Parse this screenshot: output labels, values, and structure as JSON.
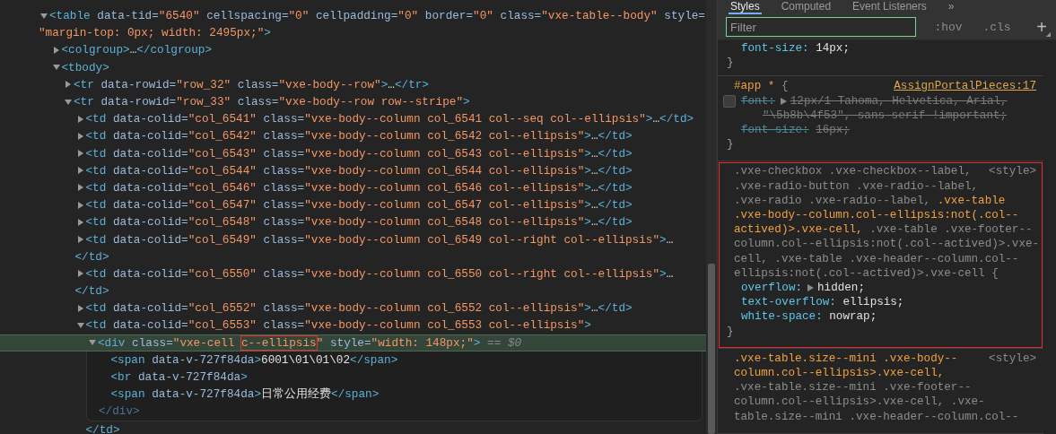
{
  "elements": [
    {
      "selected": false,
      "expanded": true,
      "lines": [
        [
          {
            "kind": "tag",
            "text": "<table"
          },
          {
            "kind": "attr",
            "text": " data-tid="
          },
          {
            "kind": "val",
            "text": "\"6540\""
          },
          {
            "kind": "attr",
            "text": " cellspacing="
          },
          {
            "kind": "val",
            "text": "\"0\""
          },
          {
            "kind": "attr",
            "text": " cellpadding="
          },
          {
            "kind": "val",
            "text": "\"0\""
          },
          {
            "kind": "attr",
            "text": " border="
          },
          {
            "kind": "val",
            "text": "\"0\""
          },
          {
            "kind": "attr",
            "text": " class="
          },
          {
            "kind": "val",
            "text": "\"vxe-table--body\""
          },
          {
            "kind": "attr",
            "text": " style="
          }
        ],
        [
          {
            "kind": "val",
            "text": "\"margin-top: 0px; width: 2495px;\""
          },
          {
            "kind": "tag",
            "text": ">"
          }
        ]
      ],
      "children": [
        {
          "selected": false,
          "expanded": false,
          "lines": [
            [
              {
                "kind": "tag",
                "text": "<colgroup>"
              },
              {
                "kind": "text",
                "text": "…"
              },
              {
                "kind": "tag",
                "text": "</colgroup>"
              }
            ]
          ]
        },
        {
          "selected": false,
          "expanded": true,
          "lines": [
            [
              {
                "kind": "tag",
                "text": "<tbody>"
              }
            ]
          ],
          "children": [
            {
              "selected": false,
              "expanded": false,
              "lines": [
                [
                  {
                    "kind": "tag",
                    "text": "<tr"
                  },
                  {
                    "kind": "attr",
                    "text": " data-rowid="
                  },
                  {
                    "kind": "val",
                    "text": "\"row_32\""
                  },
                  {
                    "kind": "attr",
                    "text": " class="
                  },
                  {
                    "kind": "val",
                    "text": "\"vxe-body--row\""
                  },
                  {
                    "kind": "tag",
                    "text": ">"
                  },
                  {
                    "kind": "text",
                    "text": "…"
                  },
                  {
                    "kind": "tag",
                    "text": "</tr>"
                  }
                ]
              ]
            },
            {
              "selected": false,
              "expanded": true,
              "lines": [
                [
                  {
                    "kind": "tag",
                    "text": "<tr"
                  },
                  {
                    "kind": "attr",
                    "text": " data-rowid="
                  },
                  {
                    "kind": "val",
                    "text": "\"row_33\""
                  },
                  {
                    "kind": "attr",
                    "text": " class="
                  },
                  {
                    "kind": "val",
                    "text": "\"vxe-body--row row--stripe\""
                  },
                  {
                    "kind": "tag",
                    "text": ">"
                  }
                ]
              ],
              "children": [
                {
                  "selected": false,
                  "expanded": false,
                  "lines": [
                    [
                      {
                        "kind": "tag",
                        "text": "<td"
                      },
                      {
                        "kind": "attr",
                        "text": " data-colid="
                      },
                      {
                        "kind": "val",
                        "text": "\"col_6541\""
                      },
                      {
                        "kind": "attr",
                        "text": " class="
                      },
                      {
                        "kind": "val",
                        "text": "\"vxe-body--column col_6541 col--seq col--ellipsis\""
                      },
                      {
                        "kind": "tag",
                        "text": ">"
                      },
                      {
                        "kind": "text",
                        "text": "…"
                      },
                      {
                        "kind": "tag",
                        "text": "</td>"
                      }
                    ]
                  ]
                },
                {
                  "selected": false,
                  "expanded": false,
                  "lines": [
                    [
                      {
                        "kind": "tag",
                        "text": "<td"
                      },
                      {
                        "kind": "attr",
                        "text": " data-colid="
                      },
                      {
                        "kind": "val",
                        "text": "\"col_6542\""
                      },
                      {
                        "kind": "attr",
                        "text": " class="
                      },
                      {
                        "kind": "val",
                        "text": "\"vxe-body--column col_6542 col--ellipsis\""
                      },
                      {
                        "kind": "tag",
                        "text": ">"
                      },
                      {
                        "kind": "text",
                        "text": "…"
                      },
                      {
                        "kind": "tag",
                        "text": "</td>"
                      }
                    ]
                  ]
                },
                {
                  "selected": false,
                  "expanded": false,
                  "lines": [
                    [
                      {
                        "kind": "tag",
                        "text": "<td"
                      },
                      {
                        "kind": "attr",
                        "text": " data-colid="
                      },
                      {
                        "kind": "val",
                        "text": "\"col_6543\""
                      },
                      {
                        "kind": "attr",
                        "text": " class="
                      },
                      {
                        "kind": "val",
                        "text": "\"vxe-body--column col_6543 col--ellipsis\""
                      },
                      {
                        "kind": "tag",
                        "text": ">"
                      },
                      {
                        "kind": "text",
                        "text": "…"
                      },
                      {
                        "kind": "tag",
                        "text": "</td>"
                      }
                    ]
                  ]
                },
                {
                  "selected": false,
                  "expanded": false,
                  "lines": [
                    [
                      {
                        "kind": "tag",
                        "text": "<td"
                      },
                      {
                        "kind": "attr",
                        "text": " data-colid="
                      },
                      {
                        "kind": "val",
                        "text": "\"col_6544\""
                      },
                      {
                        "kind": "attr",
                        "text": " class="
                      },
                      {
                        "kind": "val",
                        "text": "\"vxe-body--column col_6544 col--ellipsis\""
                      },
                      {
                        "kind": "tag",
                        "text": ">"
                      },
                      {
                        "kind": "text",
                        "text": "…"
                      },
                      {
                        "kind": "tag",
                        "text": "</td>"
                      }
                    ]
                  ]
                },
                {
                  "selected": false,
                  "expanded": false,
                  "lines": [
                    [
                      {
                        "kind": "tag",
                        "text": "<td"
                      },
                      {
                        "kind": "attr",
                        "text": " data-colid="
                      },
                      {
                        "kind": "val",
                        "text": "\"col_6546\""
                      },
                      {
                        "kind": "attr",
                        "text": " class="
                      },
                      {
                        "kind": "val",
                        "text": "\"vxe-body--column col_6546 col--ellipsis\""
                      },
                      {
                        "kind": "tag",
                        "text": ">"
                      },
                      {
                        "kind": "text",
                        "text": "…"
                      },
                      {
                        "kind": "tag",
                        "text": "</td>"
                      }
                    ]
                  ]
                },
                {
                  "selected": false,
                  "expanded": false,
                  "lines": [
                    [
                      {
                        "kind": "tag",
                        "text": "<td"
                      },
                      {
                        "kind": "attr",
                        "text": " data-colid="
                      },
                      {
                        "kind": "val",
                        "text": "\"col_6547\""
                      },
                      {
                        "kind": "attr",
                        "text": " class="
                      },
                      {
                        "kind": "val",
                        "text": "\"vxe-body--column col_6547 col--ellipsis\""
                      },
                      {
                        "kind": "tag",
                        "text": ">"
                      },
                      {
                        "kind": "text",
                        "text": "…"
                      },
                      {
                        "kind": "tag",
                        "text": "</td>"
                      }
                    ]
                  ]
                },
                {
                  "selected": false,
                  "expanded": false,
                  "lines": [
                    [
                      {
                        "kind": "tag",
                        "text": "<td"
                      },
                      {
                        "kind": "attr",
                        "text": " data-colid="
                      },
                      {
                        "kind": "val",
                        "text": "\"col_6548\""
                      },
                      {
                        "kind": "attr",
                        "text": " class="
                      },
                      {
                        "kind": "val",
                        "text": "\"vxe-body--column col_6548 col--ellipsis\""
                      },
                      {
                        "kind": "tag",
                        "text": ">"
                      },
                      {
                        "kind": "text",
                        "text": "…"
                      },
                      {
                        "kind": "tag",
                        "text": "</td>"
                      }
                    ]
                  ]
                },
                {
                  "selected": false,
                  "expanded": false,
                  "lines": [
                    [
                      {
                        "kind": "tag",
                        "text": "<td"
                      },
                      {
                        "kind": "attr",
                        "text": " data-colid="
                      },
                      {
                        "kind": "val",
                        "text": "\"col_6549\""
                      },
                      {
                        "kind": "attr",
                        "text": " class="
                      },
                      {
                        "kind": "val",
                        "text": "\"vxe-body--column col_6549 col--right col--ellipsis\""
                      },
                      {
                        "kind": "tag",
                        "text": ">"
                      },
                      {
                        "kind": "text",
                        "text": "…"
                      }
                    ],
                    [
                      {
                        "kind": "tag",
                        "text": "</td>"
                      }
                    ]
                  ]
                },
                {
                  "selected": false,
                  "expanded": false,
                  "lines": [
                    [
                      {
                        "kind": "tag",
                        "text": "<td"
                      },
                      {
                        "kind": "attr",
                        "text": " data-colid="
                      },
                      {
                        "kind": "val",
                        "text": "\"col_6550\""
                      },
                      {
                        "kind": "attr",
                        "text": " class="
                      },
                      {
                        "kind": "val",
                        "text": "\"vxe-body--column col_6550 col--right col--ellipsis\""
                      },
                      {
                        "kind": "tag",
                        "text": ">"
                      },
                      {
                        "kind": "text",
                        "text": "…"
                      }
                    ],
                    [
                      {
                        "kind": "tag",
                        "text": "</td>"
                      }
                    ]
                  ]
                },
                {
                  "selected": false,
                  "expanded": false,
                  "lines": [
                    [
                      {
                        "kind": "tag",
                        "text": "<td"
                      },
                      {
                        "kind": "attr",
                        "text": " data-colid="
                      },
                      {
                        "kind": "val",
                        "text": "\"col_6552\""
                      },
                      {
                        "kind": "attr",
                        "text": " class="
                      },
                      {
                        "kind": "val",
                        "text": "\"vxe-body--column col_6552 col--ellipsis\""
                      },
                      {
                        "kind": "tag",
                        "text": ">"
                      },
                      {
                        "kind": "text",
                        "text": "…"
                      },
                      {
                        "kind": "tag",
                        "text": "</td>"
                      }
                    ]
                  ]
                },
                {
                  "selected": false,
                  "expanded": true,
                  "lines": [
                    [
                      {
                        "kind": "tag",
                        "text": "<td"
                      },
                      {
                        "kind": "attr",
                        "text": " data-colid="
                      },
                      {
                        "kind": "val",
                        "text": "\"col_6553\""
                      },
                      {
                        "kind": "attr",
                        "text": " class="
                      },
                      {
                        "kind": "val",
                        "text": "\"vxe-body--column col_6553 col--ellipsis\""
                      },
                      {
                        "kind": "tag",
                        "text": ">"
                      }
                    ]
                  ],
                  "children": [
                    {
                      "selected": true,
                      "expanded": true,
                      "lines": [
                        [
                          {
                            "kind": "tag",
                            "text": "<div"
                          },
                          {
                            "kind": "attr",
                            "text": " class="
                          },
                          {
                            "kind": "val",
                            "text": "\"vxe-cell "
                          },
                          {
                            "kind": "boxed",
                            "text": "c--ellipsis"
                          },
                          {
                            "kind": "val",
                            "text": "\""
                          },
                          {
                            "kind": "attr",
                            "text": " style="
                          },
                          {
                            "kind": "val",
                            "text": "\"width: 148px;\""
                          },
                          {
                            "kind": "tag",
                            "text": ">"
                          },
                          {
                            "kind": "dim",
                            "text": " == $0"
                          }
                        ]
                      ],
                      "children": [
                        {
                          "selected": false,
                          "lines": [
                            [
                              {
                                "kind": "tag",
                                "text": "<span"
                              },
                              {
                                "kind": "attr",
                                "text": " data-v-727f84da"
                              },
                              {
                                "kind": "tag",
                                "text": ">"
                              },
                              {
                                "kind": "text",
                                "text": "6001\\01\\01\\02"
                              },
                              {
                                "kind": "tag",
                                "text": "</span>"
                              }
                            ]
                          ]
                        },
                        {
                          "selected": false,
                          "lines": [
                            [
                              {
                                "kind": "tag",
                                "text": "<br"
                              },
                              {
                                "kind": "attr",
                                "text": " data-v-727f84da"
                              },
                              {
                                "kind": "tag",
                                "text": ">"
                              }
                            ]
                          ]
                        },
                        {
                          "selected": false,
                          "lines": [
                            [
                              {
                                "kind": "tag",
                                "text": "<span"
                              },
                              {
                                "kind": "attr",
                                "text": " data-v-727f84da"
                              },
                              {
                                "kind": "tag",
                                "text": ">"
                              },
                              {
                                "kind": "text",
                                "text": "日常公用经费"
                              },
                              {
                                "kind": "tag",
                                "text": "</span>"
                              }
                            ]
                          ]
                        }
                      ],
                      "close": [
                        [
                          {
                            "kind": "closedim",
                            "text": "</div>"
                          }
                        ]
                      ]
                    }
                  ],
                  "close": [
                    [
                      {
                        "kind": "tag",
                        "text": "</td>"
                      }
                    ]
                  ]
                }
              ]
            }
          ]
        }
      ]
    }
  ],
  "styles_pane": {
    "tabs": [
      {
        "label": "Styles",
        "selected": true
      },
      {
        "label": "Computed",
        "selected": false
      },
      {
        "label": "Event Listeners",
        "selected": false
      },
      {
        "label": "»",
        "selected": false
      }
    ],
    "filter": {
      "placeholder": "Filter"
    },
    "toolbar": [
      ":hov",
      ".cls",
      "+"
    ],
    "rules": [
      {
        "highlighted": false,
        "declarations": [
          {
            "property": "font-size:",
            "value": [
              "14px;"
            ],
            "overridden": false,
            "expandable": false
          }
        ],
        "close": "}"
      },
      {
        "highlighted": false,
        "source": "AssignPortalPieces:17",
        "selector_lines": [
          [
            {
              "kind": "match",
              "text": "#app *"
            },
            {
              "kind": "plain",
              "text": " {"
            }
          ]
        ],
        "declarations": [
          {
            "property": "font:",
            "value": [
              "12px/1 Tahoma, Helvetica, Arial,",
              "\"\\5b8b\\4f53\", sans-serif !important;"
            ],
            "overridden": true,
            "expandable": true,
            "checked": false
          },
          {
            "property": "font-size:",
            "value": [
              "16px;"
            ],
            "overridden": true,
            "expandable": false
          }
        ],
        "close": "}"
      },
      {
        "highlighted": true,
        "source": "<style>",
        "selector_lines": [
          [
            {
              "kind": "plain",
              "text": ".vxe-checkbox .vxe-checkbox--label,"
            }
          ],
          [
            {
              "kind": "plain",
              "text": ".vxe-radio-button .vxe-radio--label,"
            }
          ],
          [
            {
              "kind": "plain",
              "text": ".vxe-radio .vxe-radio--label, "
            },
            {
              "kind": "match",
              "text": ".vxe-table"
            }
          ],
          [
            {
              "kind": "match",
              "text": ".vxe-body--column.col--ellipsis:not(.col--"
            }
          ],
          [
            {
              "kind": "match",
              "text": "actived)>.vxe-cell,"
            },
            {
              "kind": "plain",
              "text": " .vxe-table .vxe-footer--"
            }
          ],
          [
            {
              "kind": "plain",
              "text": "column.col--ellipsis:not(.col--actived)>.vxe-"
            }
          ],
          [
            {
              "kind": "plain",
              "text": "cell, .vxe-table .vxe-header--column.col--"
            }
          ],
          [
            {
              "kind": "plain",
              "text": "ellipsis:not(.col--actived)>.vxe-cell {"
            }
          ]
        ],
        "declarations": [
          {
            "property": "overflow:",
            "value": [
              "hidden;"
            ],
            "overridden": false,
            "expandable": true
          },
          {
            "property": "text-overflow:",
            "value": [
              "ellipsis;"
            ],
            "overridden": false,
            "expandable": false
          },
          {
            "property": "white-space:",
            "value": [
              "nowrap;"
            ],
            "overridden": false,
            "expandable": false
          }
        ],
        "close": "}"
      },
      {
        "highlighted": false,
        "source": "<style>",
        "selector_lines": [
          [
            {
              "kind": "match",
              "text": ".vxe-table.size--mini .vxe-body--"
            }
          ],
          [
            {
              "kind": "match",
              "text": "column.col--ellipsis>.vxe-cell,"
            }
          ],
          [
            {
              "kind": "plain",
              "text": ".vxe-table.size--mini .vxe-footer--"
            }
          ],
          [
            {
              "kind": "plain",
              "text": "column.col--ellipsis>.vxe-cell, .vxe-"
            }
          ],
          [
            {
              "kind": "plain",
              "text": "table.size--mini .vxe-header--column.col--"
            }
          ]
        ]
      }
    ]
  }
}
